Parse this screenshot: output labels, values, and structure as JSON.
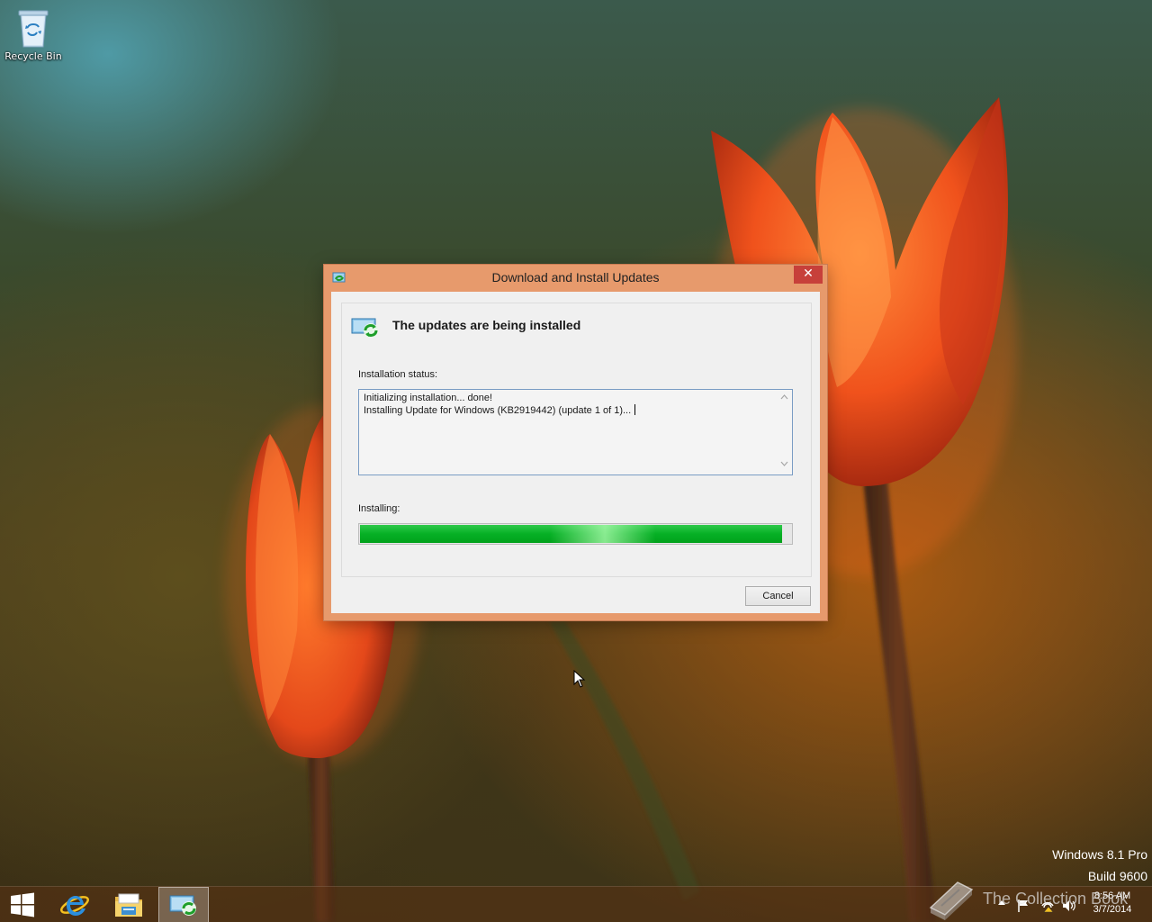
{
  "desktop": {
    "icons": [
      {
        "label": "Recycle Bin",
        "icon": "recycle-bin-icon"
      }
    ],
    "watermark": {
      "line1": "Windows 8.1 Pro",
      "line2": "Build 9600"
    },
    "overlay_text": "The Collection Book"
  },
  "dialog": {
    "title": "Download and Install Updates",
    "close_label": "✕",
    "heading": "The updates are being installed",
    "status_label": "Installation status:",
    "status_lines": [
      "Initializing installation... done!",
      "Installing Update for Windows (KB2919442) (update 1 of 1)..."
    ],
    "progress_label": "Installing:",
    "progress_fraction": 0.98,
    "cancel_label": "Cancel",
    "colors": {
      "frame": "#e79a6c",
      "close": "#c7403a",
      "progress": "#06b025"
    }
  },
  "taskbar": {
    "pinned": [
      {
        "name": "start-button",
        "icon": "windows-logo-icon"
      },
      {
        "name": "internet-explorer",
        "icon": "internet-explorer-icon"
      },
      {
        "name": "file-explorer",
        "icon": "folder-icon"
      },
      {
        "name": "windows-update",
        "icon": "windows-update-icon",
        "active": true
      }
    ],
    "tray_icons": [
      "show-hidden-icons-icon",
      "action-center-flag-icon",
      "network-icon",
      "volume-icon"
    ],
    "clock": {
      "time": "8:56 AM",
      "date": "3/7/2014"
    }
  }
}
